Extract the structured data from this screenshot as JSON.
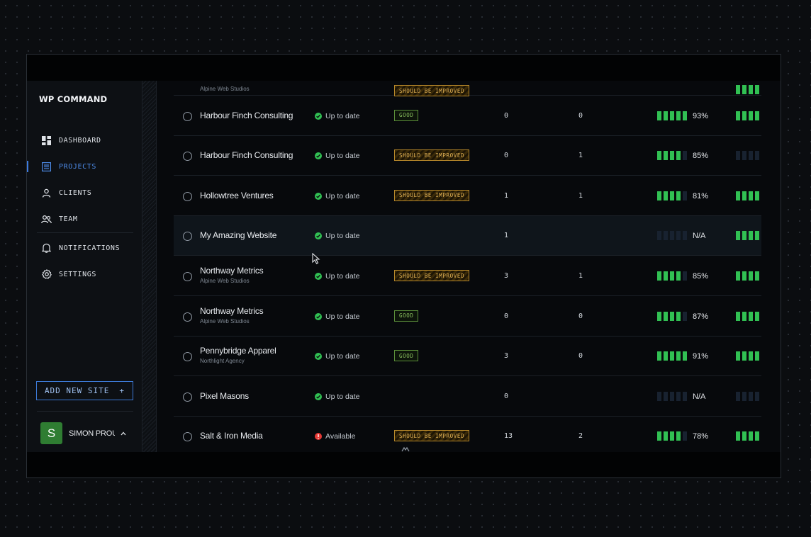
{
  "app": {
    "logo_text": "WP COMMAND"
  },
  "nav": {
    "items": [
      {
        "id": "dashboard",
        "label": "DASHBOARD",
        "icon": "dashboard-icon"
      },
      {
        "id": "projects",
        "label": "PROJECTS",
        "icon": "list-icon",
        "active": true
      },
      {
        "id": "clients",
        "label": "CLIENTS",
        "icon": "user-icon"
      },
      {
        "id": "team",
        "label": "TEAM",
        "icon": "team-icon"
      },
      {
        "id": "notifications",
        "label": "NOTIFICATIONS",
        "icon": "bell-icon"
      },
      {
        "id": "settings",
        "label": "SETTINGS",
        "icon": "gear-icon"
      }
    ]
  },
  "add_site": {
    "label": "ADD NEW SITE",
    "icon": "+"
  },
  "user": {
    "initial": "S",
    "name": "SIMON PROU..."
  },
  "colors": {
    "accent": "#3d7be0",
    "good": "#31c053",
    "warn": "#e4b457",
    "error": "#e53935"
  },
  "rows": [
    {
      "name": "",
      "sub": "Alpine Web Studios",
      "status": "",
      "badge": "SHOULD BE IMPROVED",
      "badge_type": "warn",
      "a": "",
      "b": "",
      "score_bars": 0,
      "pct": "",
      "health_bars": 4
    },
    {
      "name": "Harbour Finch Consulting",
      "sub": "",
      "status": "Up to date",
      "status_type": "ok",
      "badge": "GOOD",
      "badge_type": "good",
      "a": "0",
      "b": "0",
      "score_bars": 5,
      "pct": "93%",
      "health_bars": 4
    },
    {
      "name": "Harbour Finch Consulting",
      "sub": "",
      "status": "Up to date",
      "status_type": "ok",
      "badge": "SHOULD BE IMPROVED",
      "badge_type": "warn",
      "a": "0",
      "b": "1",
      "score_bars": 4,
      "pct": "85%",
      "health_bars": 0
    },
    {
      "name": "Hollowtree Ventures",
      "sub": "",
      "status": "Up to date",
      "status_type": "ok",
      "badge": "SHOULD BE IMPROVED",
      "badge_type": "warn",
      "a": "1",
      "b": "1",
      "score_bars": 4,
      "pct": "81%",
      "health_bars": 4
    },
    {
      "name": "My Amazing Website",
      "sub": "",
      "status": "Up to date",
      "status_type": "ok",
      "badge": "",
      "badge_type": "",
      "a": "1",
      "b": "",
      "score_bars": 0,
      "pct": "N/A",
      "health_bars": 4,
      "highlight": true
    },
    {
      "name": "Northway Metrics",
      "sub": "Alpine Web Studios",
      "status": "Up to date",
      "status_type": "ok",
      "badge": "SHOULD BE IMPROVED",
      "badge_type": "warn",
      "a": "3",
      "b": "1",
      "score_bars": 4,
      "pct": "85%",
      "health_bars": 4
    },
    {
      "name": "Northway Metrics",
      "sub": "Alpine Web Studios",
      "status": "Up to date",
      "status_type": "ok",
      "badge": "GOOD",
      "badge_type": "good",
      "a": "0",
      "b": "0",
      "score_bars": 4,
      "pct": "87%",
      "health_bars": 4
    },
    {
      "name": "Pennybridge Apparel",
      "sub": "Northlight Agency",
      "status": "Up to date",
      "status_type": "ok",
      "badge": "GOOD",
      "badge_type": "good",
      "a": "3",
      "b": "0",
      "score_bars": 5,
      "pct": "91%",
      "health_bars": 4
    },
    {
      "name": "Pixel Masons",
      "sub": "",
      "status": "Up to date",
      "status_type": "ok",
      "badge": "",
      "badge_type": "",
      "a": "0",
      "b": "",
      "score_bars": 0,
      "pct": "N/A",
      "health_bars": 0
    },
    {
      "name": "Salt & Iron Media",
      "sub": "",
      "status": "Available",
      "status_type": "error",
      "badge": "SHOULD BE IMPROVED",
      "badge_type": "warn",
      "a": "13",
      "b": "2",
      "score_bars": 4,
      "pct": "78%",
      "health_bars": 4
    }
  ]
}
